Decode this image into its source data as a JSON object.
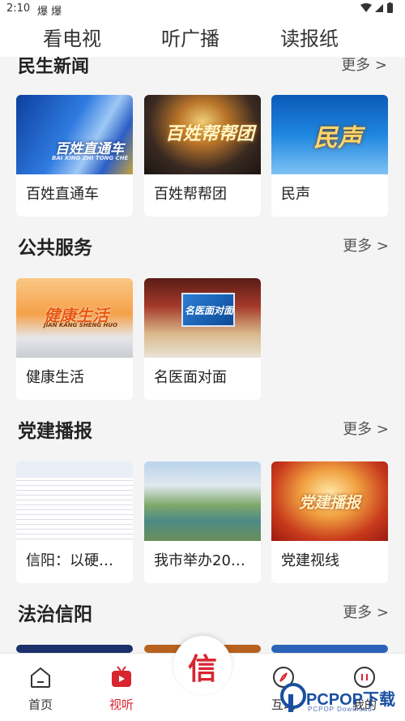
{
  "status_bar": {
    "time": "2:10",
    "left_icons": "爆 爆",
    "right_icons": "▾◢▮"
  },
  "top_tabs": [
    {
      "label": "看电视"
    },
    {
      "label": "听广播"
    },
    {
      "label": "读报纸"
    }
  ],
  "partial_section": {
    "title": "民生新闻",
    "more": "更多 >"
  },
  "sections": [
    {
      "title": "民生新闻",
      "items": [
        {
          "label": "百姓直通车",
          "thumb_text": "百姓直通车",
          "thumb_sub": "BAI XING ZHI TONG CHE"
        },
        {
          "label": "百姓帮帮团",
          "thumb_text": "百姓帮帮团"
        },
        {
          "label": "民声",
          "thumb_text": "民声"
        }
      ]
    },
    {
      "title": "公共服务",
      "more": "更多 >",
      "items": [
        {
          "label": "健康生活",
          "thumb_text": "健康生活",
          "thumb_sub": "JIAN KANG SHENG HUO"
        },
        {
          "label": "名医面对面",
          "thumb_text": "名医面对面"
        }
      ]
    },
    {
      "title": "党建播报",
      "more": "更多 >",
      "items": [
        {
          "label": "信阳：以硬…"
        },
        {
          "label": "我市举办20…"
        },
        {
          "label": "党建视线",
          "thumb_text": "党建播报"
        }
      ]
    },
    {
      "title": "法治信阳",
      "more": "更多 >"
    }
  ],
  "bottom_nav": {
    "items": [
      {
        "label": "首页",
        "icon": "home-icon"
      },
      {
        "label": "视听",
        "icon": "tv-icon",
        "active": true
      },
      {
        "label": "互动",
        "icon": "compass-icon"
      },
      {
        "label": "我的",
        "icon": "pause-circle-icon"
      }
    ],
    "center_logo": "信"
  },
  "watermark": {
    "main": "PCPOP下载",
    "sub": "PCPOP Download"
  },
  "colors": {
    "accent": "#d8252f",
    "background": "#f4f4f4"
  }
}
